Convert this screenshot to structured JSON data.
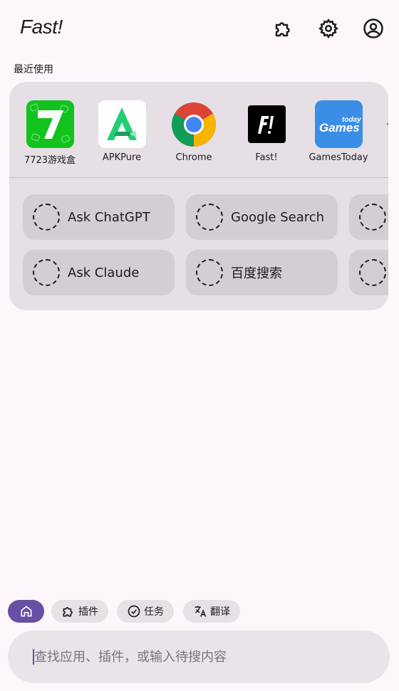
{
  "header": {
    "title": "Fast!",
    "icons": [
      "puzzle-icon",
      "gear-icon",
      "account-icon"
    ]
  },
  "recent": {
    "label": "最近使用",
    "apps": [
      {
        "label": "7723游戏盒",
        "icon": "7723-app-icon",
        "color": "#1fba2a"
      },
      {
        "label": "APKPure",
        "icon": "apkpure-app-icon",
        "color": "#24cd77"
      },
      {
        "label": "Chrome",
        "icon": "chrome-app-icon",
        "color": "#4285f4"
      },
      {
        "label": "Fast!",
        "icon": "fast-app-icon",
        "color": "#000000"
      },
      {
        "label": "GamesToday",
        "icon": "gamestoday-app-icon",
        "color": "#3b8ee6"
      }
    ],
    "actions": [
      {
        "label": "Ask ChatGPT"
      },
      {
        "label": "Google Search"
      },
      {
        "label": "Ask Claude"
      },
      {
        "label": "百度搜索"
      }
    ]
  },
  "filters": [
    {
      "label": "",
      "icon": "home-icon",
      "active": true
    },
    {
      "label": "插件",
      "icon": "puzzle-icon"
    },
    {
      "label": "任务",
      "icon": "check-circle-icon"
    },
    {
      "label": "翻译",
      "icon": "translate-icon"
    }
  ],
  "search": {
    "placeholder": "查找应用、插件，或输入待搜内容",
    "value": ""
  },
  "colors": {
    "background": "#fdf7fc",
    "card": "#e6e0e6",
    "chip": "#d3cdd4",
    "accent": "#6750a4"
  }
}
